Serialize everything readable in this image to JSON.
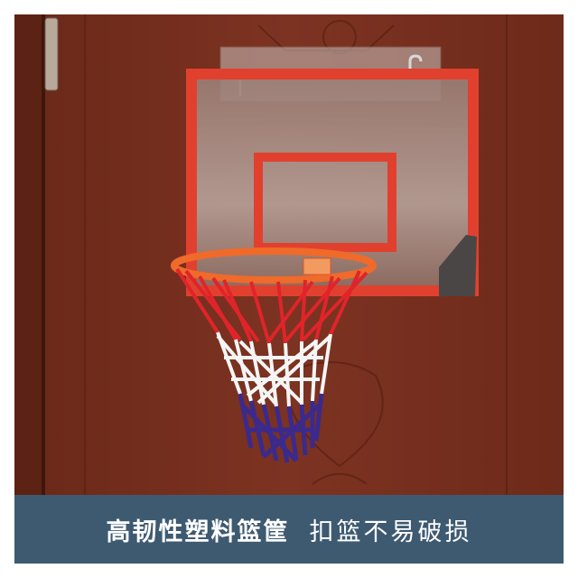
{
  "caption": {
    "headline": "高韧性塑料篮筐",
    "tagline": "扣篮不易破损",
    "bar_color": "#3e5a71"
  },
  "scene": {
    "subject": "hoop",
    "colors": {
      "door": "#7a3020",
      "rim": "#f06a2a",
      "backboard_frame": "#e2402e",
      "net_red": "#e0242a",
      "net_white": "#ffffff",
      "net_blue": "#3b2a8c"
    }
  }
}
